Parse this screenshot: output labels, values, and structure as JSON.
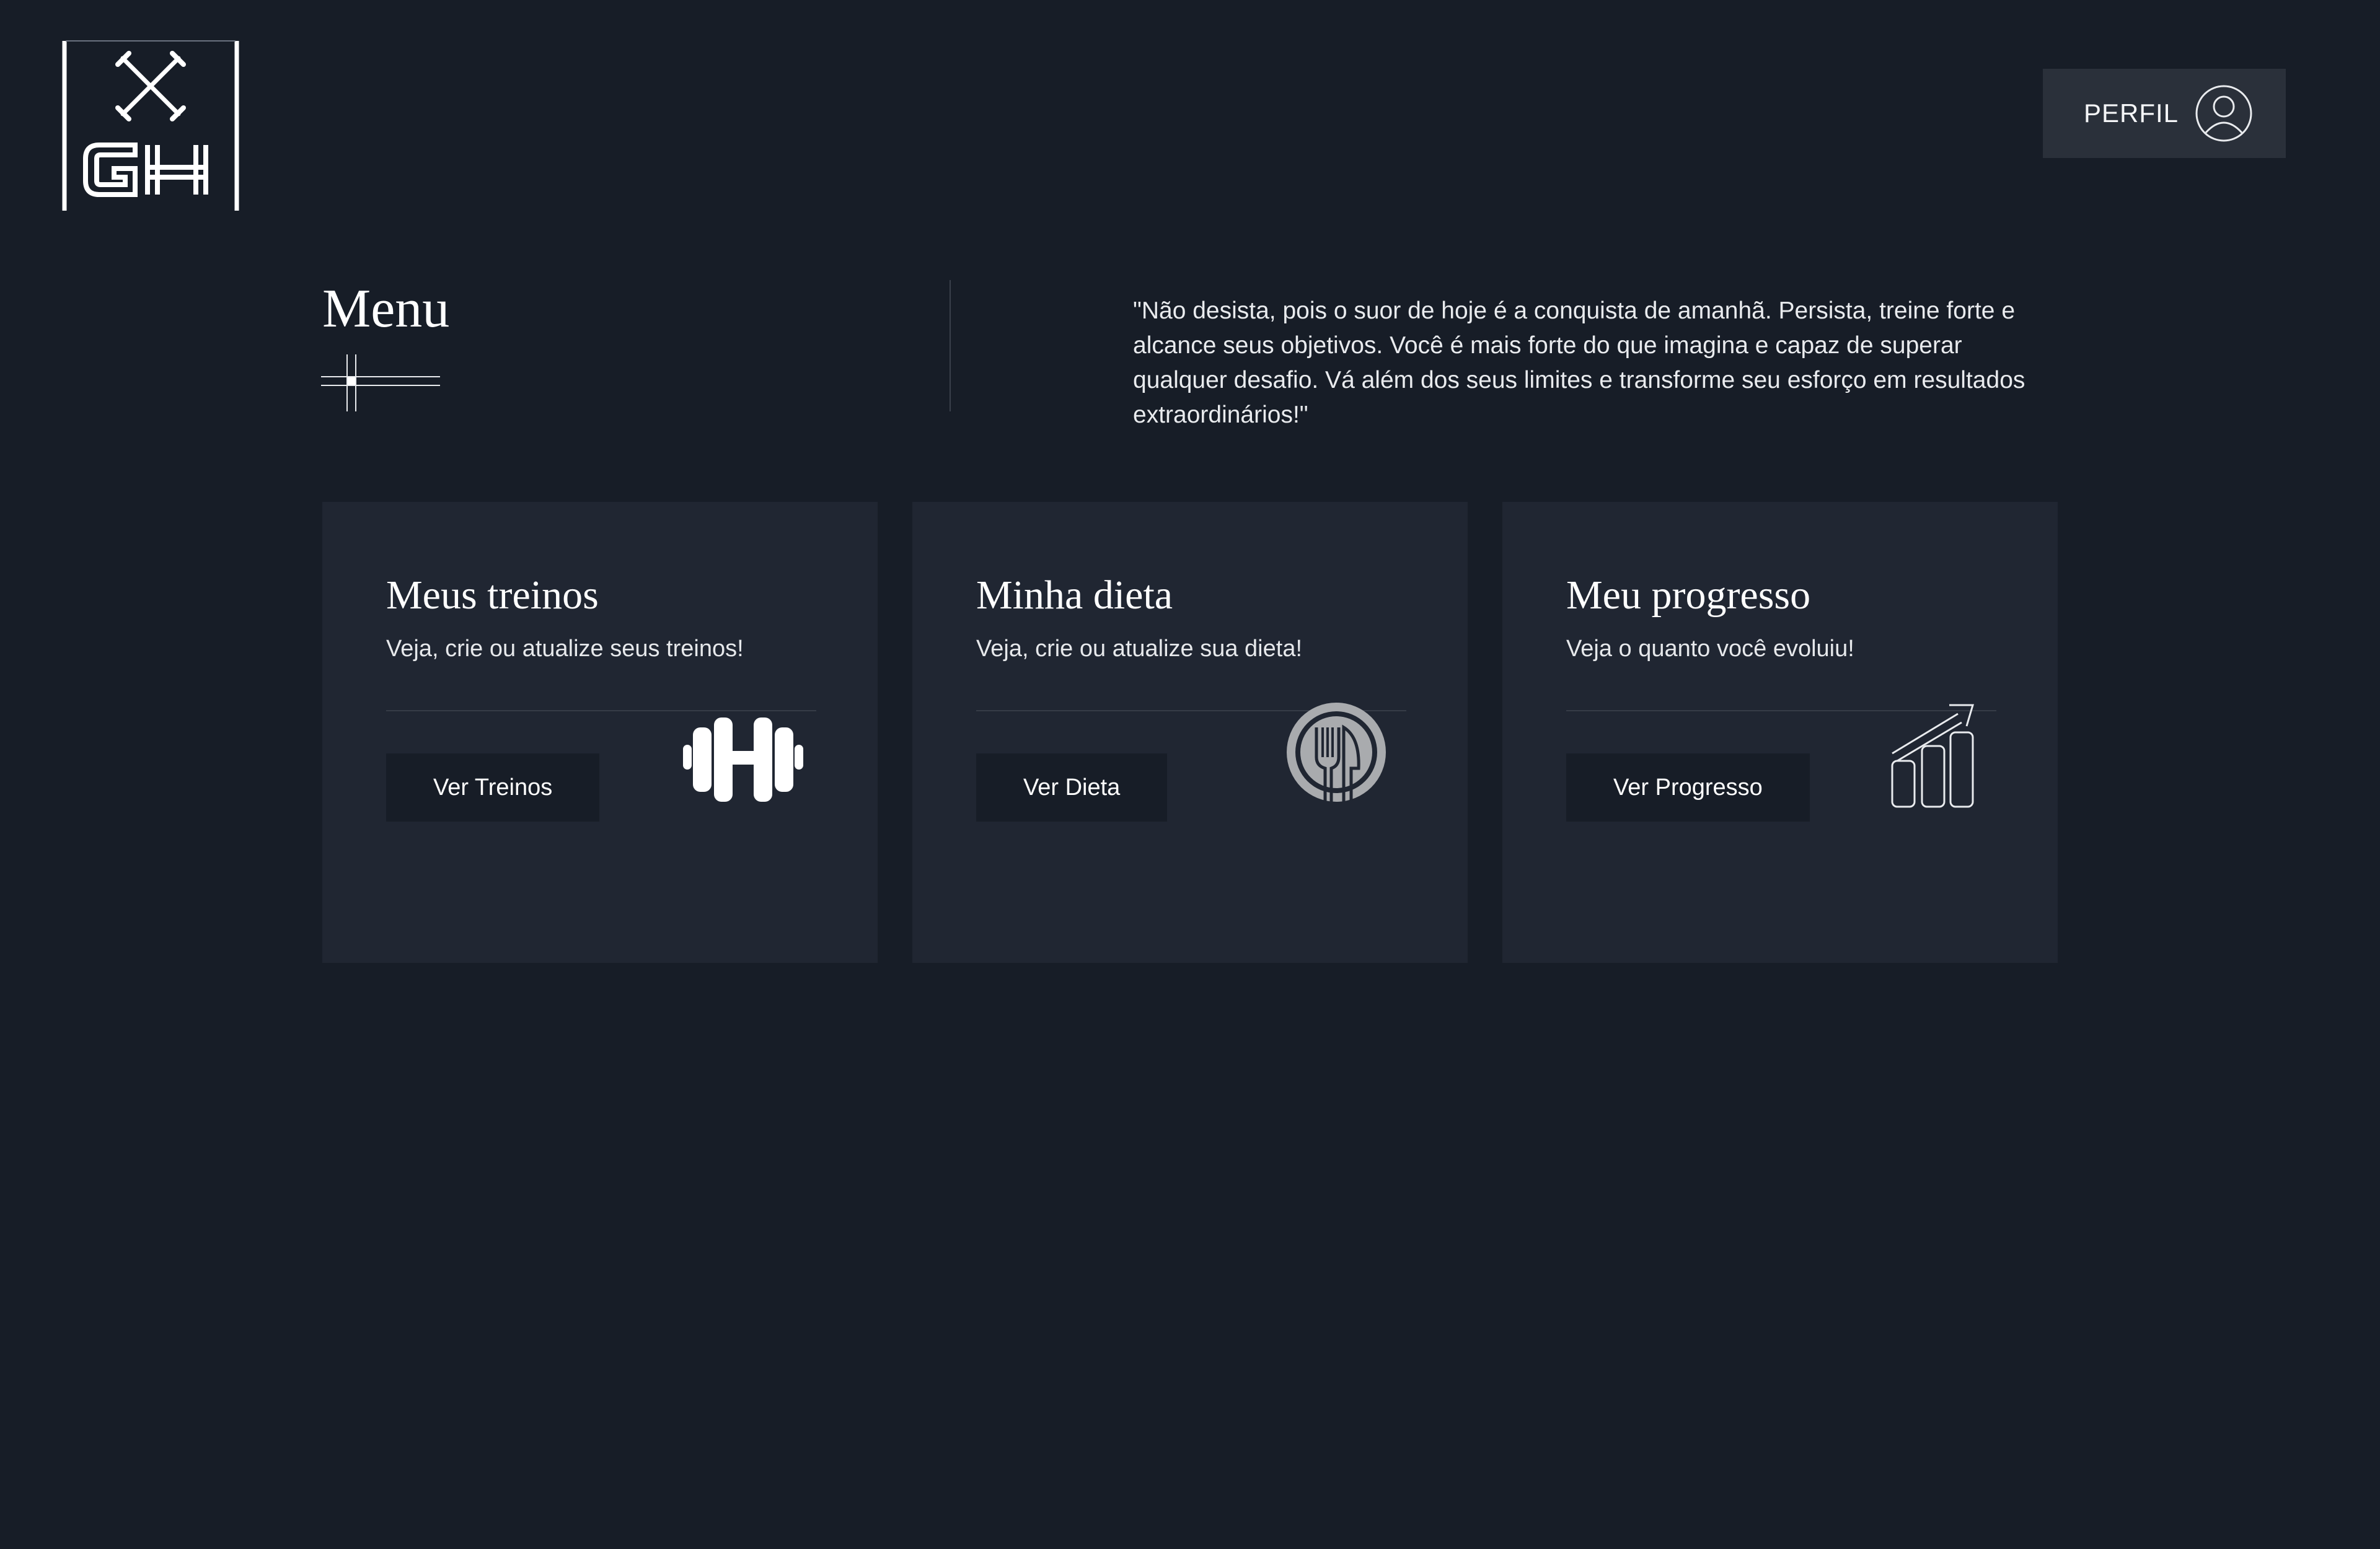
{
  "logo": {
    "text": "GH",
    "icon": "crossed-dumbbells-icon"
  },
  "header": {
    "profile_label": "PERFIL",
    "profile_icon": "user-circle-icon"
  },
  "menu": {
    "title": "Menu",
    "quote": "\"Não desista, pois o suor de hoje é a conquista de amanhã. Persista, treine forte e alcance seus objetivos. Você é mais forte do que imagina e capaz de superar qualquer desafio. Vá além dos seus limites e transforme seu esforço em resultados extraordinários!\""
  },
  "cards": [
    {
      "title": "Meus treinos",
      "subtitle": "Veja, crie ou atualize seus treinos!",
      "button": "Ver Treinos",
      "icon": "dumbbell-icon"
    },
    {
      "title": "Minha dieta",
      "subtitle": "Veja, crie ou atualize sua dieta!",
      "button": "Ver Dieta",
      "icon": "plate-fork-knife-icon"
    },
    {
      "title": "Meu progresso",
      "subtitle": "Veja o quanto você evoluiu!",
      "button": "Ver Progresso",
      "icon": "growth-chart-icon"
    }
  ],
  "colors": {
    "background": "#171d27",
    "card": "#202632",
    "button": "#171d27",
    "profile_button": "#2a303a",
    "text": "#ffffff"
  }
}
